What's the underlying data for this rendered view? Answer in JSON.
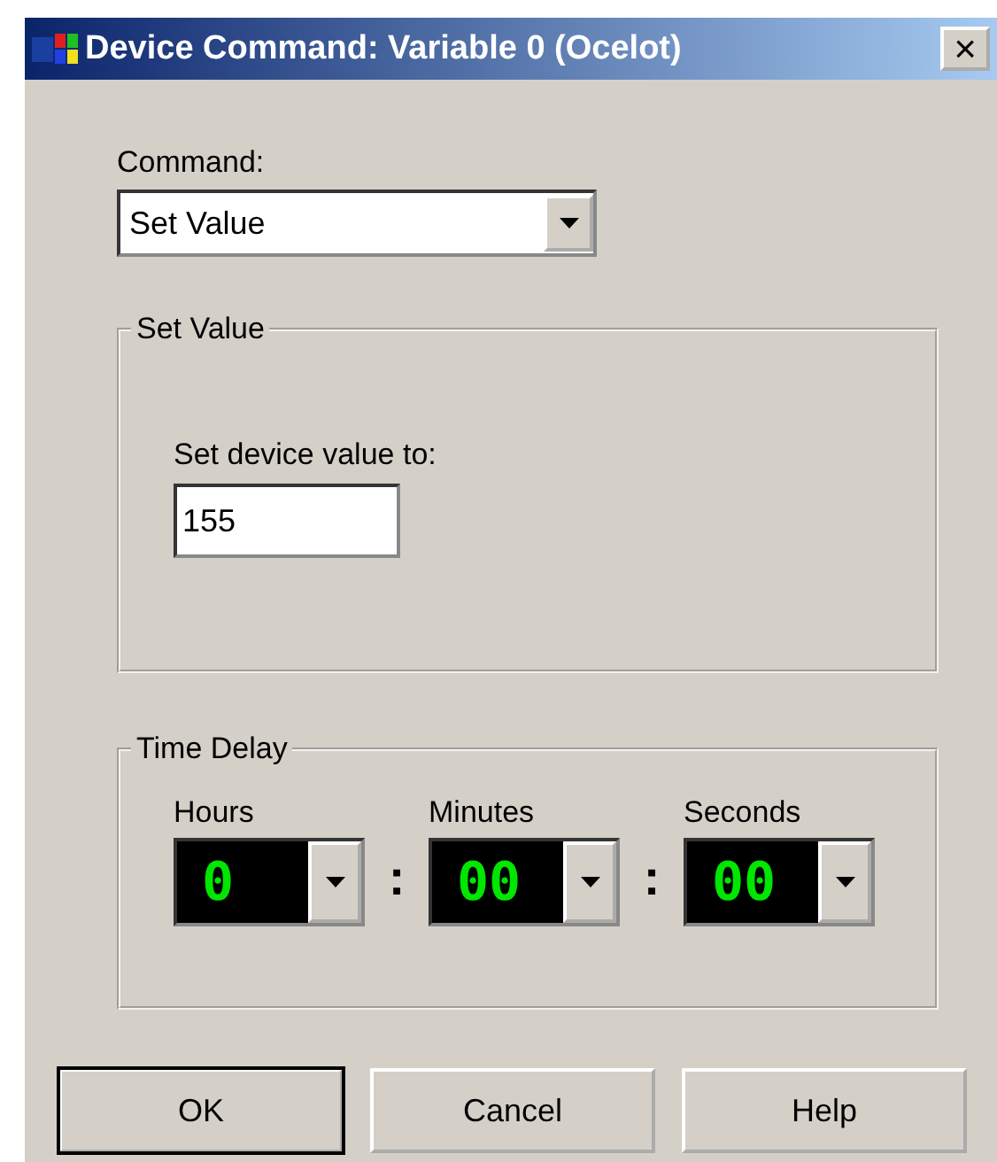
{
  "window": {
    "title": "Device Command: Variable 0 (Ocelot)",
    "close": "×"
  },
  "command": {
    "label": "Command:",
    "value": "Set Value"
  },
  "set_value": {
    "title": "Set Value",
    "label": "Set device value to:",
    "value": "155"
  },
  "time_delay": {
    "title": "Time Delay",
    "separator": ":",
    "fields": [
      {
        "label": "Hours",
        "value": "0"
      },
      {
        "label": "Minutes",
        "value": "00"
      },
      {
        "label": "Seconds",
        "value": "00"
      }
    ]
  },
  "buttons": [
    {
      "label": "OK",
      "default": true
    },
    {
      "label": "Cancel",
      "default": false
    },
    {
      "label": "Help",
      "default": false
    }
  ]
}
